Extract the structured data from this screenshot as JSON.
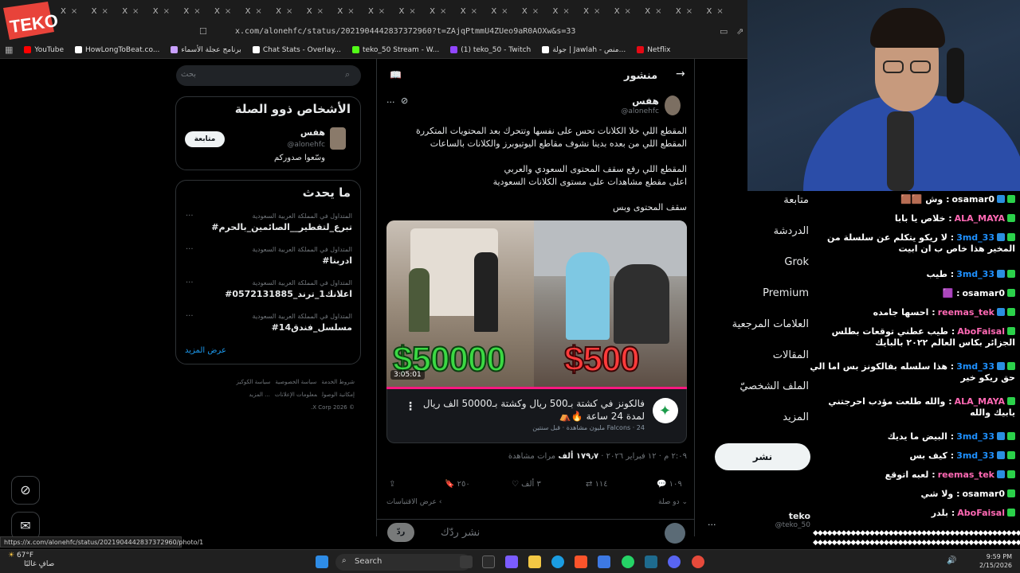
{
  "logo": {
    "text": "TEKO",
    "color": "#e8433a"
  },
  "browser": {
    "tabs": [
      "X",
      "X",
      "X",
      "X",
      "X",
      "X",
      "X",
      "X",
      "X",
      "X",
      "X",
      "X",
      "X",
      "X",
      "X",
      "X",
      "X",
      "X",
      "X",
      "X",
      "X",
      "X"
    ],
    "url": "x.com/alonehfc/status/2021904442837372960?t=ZAjqPtmmU4ZUeo9aR0AOXw&s=33",
    "bookmarks": [
      {
        "label": "YouTube",
        "color": "#ff0000"
      },
      {
        "label": "HowLongToBeat.co...",
        "color": "#ffffff"
      },
      {
        "label": "برنامج عجلة الأسماء",
        "color": "#c9a0ff"
      },
      {
        "label": "Chat Stats - Overlay...",
        "color": "#ffffff"
      },
      {
        "label": "teko_50 Stream - W...",
        "color": "#53fc18"
      },
      {
        "label": "(1) teko_50 - Twitch",
        "color": "#9146ff"
      },
      {
        "label": "جولة | Jawlah - منص...",
        "color": "#ffffff"
      },
      {
        "label": "Netflix",
        "color": "#e50914"
      }
    ]
  },
  "sidebar_right": {
    "search_placeholder": "بحث",
    "related_title": "الأشخاص ذوو الصلة",
    "person": {
      "name": "هفس",
      "handle": "@alonehfc",
      "bio": "وسّعوا صدوركم",
      "follow_label": "متابعة"
    },
    "trending_title": "ما يحدث",
    "trends": [
      {
        "category": "المتداول في المملكة العربية السعودية",
        "tag": "#تبرع_لتفطير__الصائمين_بالحرم"
      },
      {
        "category": "المتداول في المملكة العربية السعودية",
        "tag": "#ادربنا"
      },
      {
        "category": "المتداول في المملكة العربية السعودية",
        "tag": "#اعلانك1_ترند_0572131885"
      },
      {
        "category": "المتداول في المملكة العربية السعودية",
        "tag": "#مسلسل_فندق14"
      }
    ],
    "trend_more": "...",
    "show_more": "عرض المزيد",
    "footer_links": [
      "شروط الخدمة",
      "سياسة الخصوصية",
      "سياسة الكوكيز",
      "إمكانية الوصول",
      "معلومات الإعلانات",
      "... المزيد",
      "© 2026 X Corp."
    ]
  },
  "post": {
    "header_title": "منشور",
    "author_name": "هفس",
    "author_handle": "@alonehfc",
    "more": "...",
    "lines": [
      "المقطع اللي خلا الكلانات تحس على نفسها وتتحرك بعد المحتويات المتكررة",
      "المقطع اللي من بعده بدينا نشوف مقاطع اليوتيوبرز والكلانات بالساعات",
      "المقطع اللي رفع سقف المحتوى السعودي والعربي",
      "اعلى مقطع مشاهدات على مستوى الكلانات السعودية",
      "سقف المحتوى وبس"
    ],
    "video": {
      "left_price": "$50000",
      "right_price": "$500",
      "duration": "3:05:01",
      "title": "فالكونز في كشتة بـ500 ريال وكشتة بـ50000 الف ريال لمدة 24 ساعة 🔥⛺",
      "meta": "Falcons · 24 مليون مشاهدة · قبل سنتين",
      "channel_color": "#1a9b4a"
    },
    "timestamp": "٢:٠٩ م · ١٢ فبراير ٢٠٢٦ · ",
    "views_count": "١٧٩٫٧ ألف",
    "views_label": " مرات مشاهدة",
    "actions": {
      "replies": "١٠٩",
      "reposts": "١١٤",
      "likes": "٣ ألف",
      "bookmarks": "٢٥٠"
    },
    "quote_label": "دو صلة",
    "quotes_label": "عرض الاقتباسات",
    "reply_placeholder": "نشر ردّك",
    "reply_button": "ردّ"
  },
  "status_url": "https://x.com/alonehfc/status/2021904442837372960/photo/1",
  "left_nav": {
    "items": [
      "متابعة",
      "الدردشة",
      "Grok",
      "Premium",
      "العلامات المرجعية",
      "المقالات",
      "الملف الشخصيّ",
      "المزيد"
    ],
    "post_button": "نشر",
    "account_name": "teko",
    "account_handle": "@teko_50",
    "account_more": "..."
  },
  "chat": {
    "messages": [
      {
        "user": "osamar0",
        "color": "#ffffff",
        "text": "وش 🟫🟫",
        "badges": [
          "k",
          "b"
        ]
      },
      {
        "user": "ALA_MAYA",
        "color": "#ff69b4",
        "text": "خلاص يا بابا",
        "badges": [
          "k"
        ]
      },
      {
        "user": "3md_33",
        "color": "#1e90ff",
        "text": "لا ريكو يتكلم عن سلسلة من المخير هذا خاص ب ان ابيت",
        "badges": [
          "k",
          "b"
        ]
      },
      {
        "user": "3md_33",
        "color": "#1e90ff",
        "text": "طيب",
        "badges": [
          "k",
          "b"
        ]
      },
      {
        "user": "osamar0",
        "color": "#ffffff",
        "text": "🟪",
        "badges": [
          "k"
        ]
      },
      {
        "user": "reemas_tek",
        "color": "#ff69b4",
        "text": "احسها جامده",
        "badges": [
          "k",
          "b"
        ]
      },
      {
        "user": "AboFaisal",
        "color": "#ff69b4",
        "text": "طيب عطني توقعات بطلس الجزائر بكاس العالم ٢٠٢٢ بالبايك",
        "badges": [
          "k"
        ]
      },
      {
        "user": "3md_33",
        "color": "#1e90ff",
        "text": "هذا سلسله بفالكونز بس اما الي حق ريكو خير",
        "badges": [
          "k",
          "b"
        ]
      },
      {
        "user": "ALA_MAYA",
        "color": "#ff69b4",
        "text": "والله طلعت مؤدب احرجتني يابيك والله",
        "badges": [
          "k"
        ]
      },
      {
        "user": "3md_33",
        "color": "#1e90ff",
        "text": "البيض ما يديك",
        "badges": [
          "k",
          "b"
        ]
      },
      {
        "user": "3md_33",
        "color": "#1e90ff",
        "text": "كيف بس",
        "badges": [
          "k",
          "b"
        ]
      },
      {
        "user": "reemas_tek",
        "color": "#ff69b4",
        "text": "لعبه اتوقع",
        "badges": [
          "k",
          "b"
        ]
      },
      {
        "user": "osamar0",
        "color": "#ffffff",
        "text": "ولا شي",
        "badges": [
          "k"
        ]
      },
      {
        "user": "AboFaisal",
        "color": "#ff69b4",
        "text": "بلدر",
        "badges": [
          "k"
        ]
      }
    ]
  },
  "taskbar": {
    "search": "Search",
    "weather_temp": "67°F",
    "weather_desc": "صافٍ غالبًا",
    "time": "9:59 PM",
    "date": "2/15/2026"
  }
}
